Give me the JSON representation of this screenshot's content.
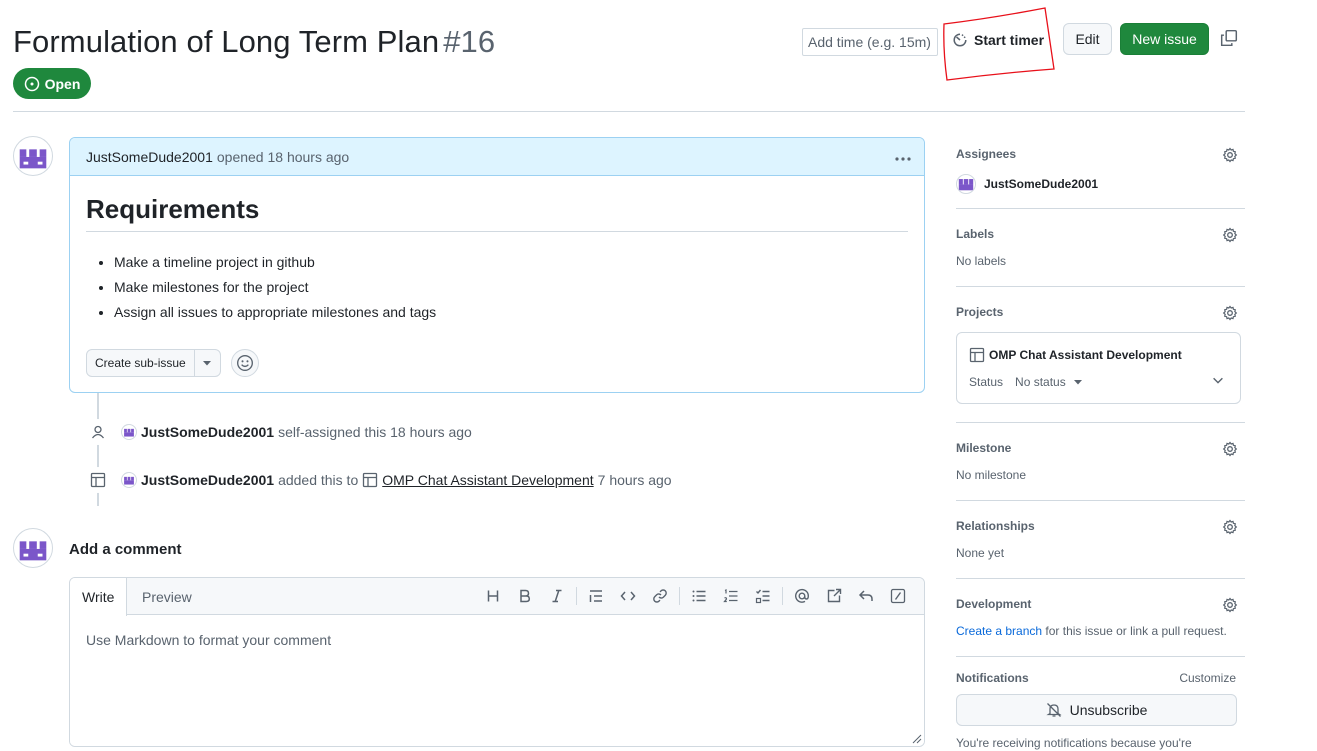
{
  "issue": {
    "title": "Formulation of Long Term Plan",
    "number": "#16",
    "state": "Open"
  },
  "header": {
    "time_placeholder": "Add time (e.g. 15m)",
    "start_timer": "Start timer",
    "edit": "Edit",
    "new_issue": "New issue"
  },
  "comment": {
    "author": "JustSomeDude2001",
    "meta": "opened 18 hours ago",
    "heading": "Requirements",
    "items": [
      "Make a timeline project in github",
      "Make milestones for the project",
      "Assign all issues to appropriate milestones and tags"
    ],
    "create_sub_issue": "Create sub-issue"
  },
  "timeline": [
    {
      "icon": "person-icon",
      "actor": "JustSomeDude2001",
      "text": "self-assigned this 18 hours ago"
    },
    {
      "icon": "table-icon",
      "actor": "JustSomeDude2001",
      "pre": "added this to",
      "link": "OMP Chat Assistant Development",
      "post": "7 hours ago"
    }
  ],
  "add_comment": {
    "heading": "Add a comment",
    "tab_write": "Write",
    "tab_preview": "Preview",
    "placeholder": "Use Markdown to format your comment"
  },
  "sidebar": {
    "assignees": {
      "title": "Assignees",
      "value": "JustSomeDude2001"
    },
    "labels": {
      "title": "Labels",
      "value": "No labels"
    },
    "projects": {
      "title": "Projects",
      "project_name": "OMP Chat Assistant Development",
      "status_label": "Status",
      "status_value": "No status"
    },
    "milestone": {
      "title": "Milestone",
      "value": "No milestone"
    },
    "relationships": {
      "title": "Relationships",
      "value": "None yet"
    },
    "development": {
      "title": "Development",
      "link": "Create a branch",
      "rest": "for this issue or link a pull request."
    },
    "notifications": {
      "title": "Notifications",
      "customize": "Customize",
      "unsubscribe": "Unsubscribe",
      "note": "You're receiving notifications because you're"
    }
  },
  "colors": {
    "open_green": "#1f883d",
    "link_blue": "#0969da",
    "comment_header_bg": "#ddf4ff",
    "annotation_red": "#e8101a"
  }
}
